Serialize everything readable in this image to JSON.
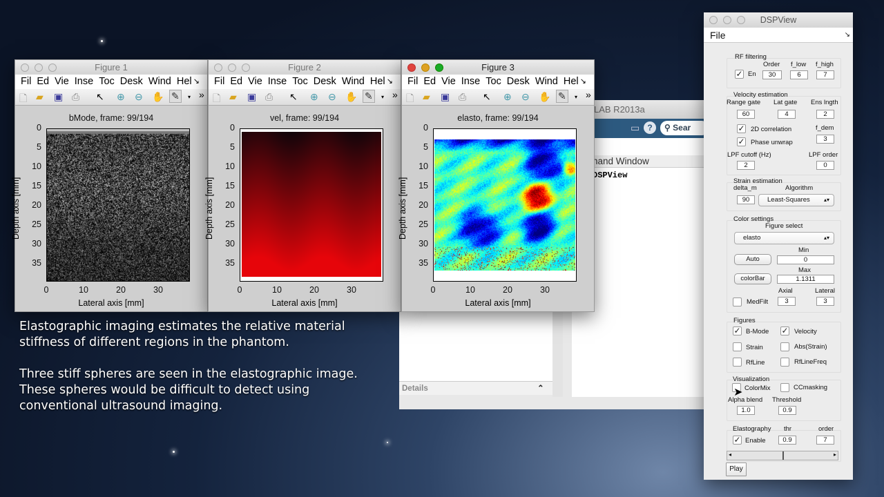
{
  "caption": {
    "p1_line1": "Elastographic imaging estimates the relative material",
    "p1_line2": "stiffness of different regions in the phantom.",
    "p2_line1": "Three stiff spheres are seen in the elastographic image.",
    "p2_line2": "These spheres would be difficult to detect using",
    "p2_line3": "conventional ultrasound imaging."
  },
  "matlab": {
    "title": "LAB R2013a",
    "search": "Sear",
    "command_window": "hand Window",
    "command": "DSPView",
    "details": "Details"
  },
  "figures": [
    {
      "window_title": "Figure 1",
      "plot_title": "bMode, frame: 99/194",
      "kind": "bmode"
    },
    {
      "window_title": "Figure 2",
      "plot_title": "vel, frame: 99/194",
      "kind": "vel"
    },
    {
      "window_title": "Figure 3",
      "plot_title": "elasto, frame: 99/194",
      "kind": "elasto"
    }
  ],
  "figure_menu": [
    "Fil",
    "Ed",
    "Vie",
    "Inse",
    "Toc",
    "Desk",
    "Wind",
    "Hel"
  ],
  "axes": {
    "xlabel": "Lateral axis [mm]",
    "ylabel": "Depth axis [mm]",
    "xticks": [
      "0",
      "10",
      "20",
      "30"
    ],
    "yticks": [
      "0",
      "5",
      "10",
      "15",
      "20",
      "25",
      "30",
      "35"
    ]
  },
  "dsp": {
    "title": "DSPView",
    "menu_file": "File",
    "rf": {
      "label": "RF filtering",
      "order_label": "Order",
      "flow_label": "f_low",
      "fhigh_label": "f_high",
      "en_label": "En",
      "en": true,
      "order": "30",
      "f_low": "6",
      "f_high": "7"
    },
    "vel": {
      "label": "Velocity estimation",
      "range_gate_label": "Range gate",
      "lat_gate_label": "Lat gate",
      "ens_label": "Ens lngth",
      "range_gate": "60",
      "lat_gate": "4",
      "ens": "2",
      "corr_label": "2D correlation",
      "corr": true,
      "fdem_label": "f_dem",
      "fdem": "3",
      "unwrap_label": "Phase unwrap",
      "unwrap": true,
      "lpf_cutoff_label": "LPF cutoff (Hz)",
      "lpf_order_label": "LPF order",
      "lpf_cutoff": "2",
      "lpf_order": "0"
    },
    "strain": {
      "label": "Strain estimation",
      "delta_label": "delta_m",
      "algo_label": "Algorithm",
      "delta": "90",
      "algorithm": "Least-Squares"
    },
    "color": {
      "label": "Color settings",
      "figsel_label": "Figure select",
      "figsel": "elasto",
      "min_label": "Min",
      "auto_label": "Auto",
      "min": "0",
      "max_label": "Max",
      "colorbar_label": "colorBar",
      "max": "1.1311",
      "axial_label": "Axial",
      "lateral_label": "Lateral",
      "medfilt_label": "MedFilt",
      "axial": "3",
      "lateral": "3"
    },
    "figures": {
      "label": "Figures",
      "bmode": "B-Mode",
      "velocity": "Velocity",
      "strain": "Strain",
      "abs_strain": "Abs(Strain)",
      "rfline": "RfLine",
      "rflinefreq": "RfLineFreq"
    },
    "vis": {
      "label": "Visualization",
      "colormix": "ColorMix",
      "ccmasking": "CCmasking",
      "alpha_label": "Alpha blend",
      "threshold_label": "Threshold",
      "alpha": "1.0",
      "threshold": "0.9"
    },
    "elasto": {
      "label": "Elastography",
      "thr_label": "thr",
      "order_label": "order",
      "enable_label": "Enable",
      "thr": "0.9",
      "order": "7",
      "slider_value": 0.5
    },
    "play": "Play"
  },
  "check": "✓"
}
